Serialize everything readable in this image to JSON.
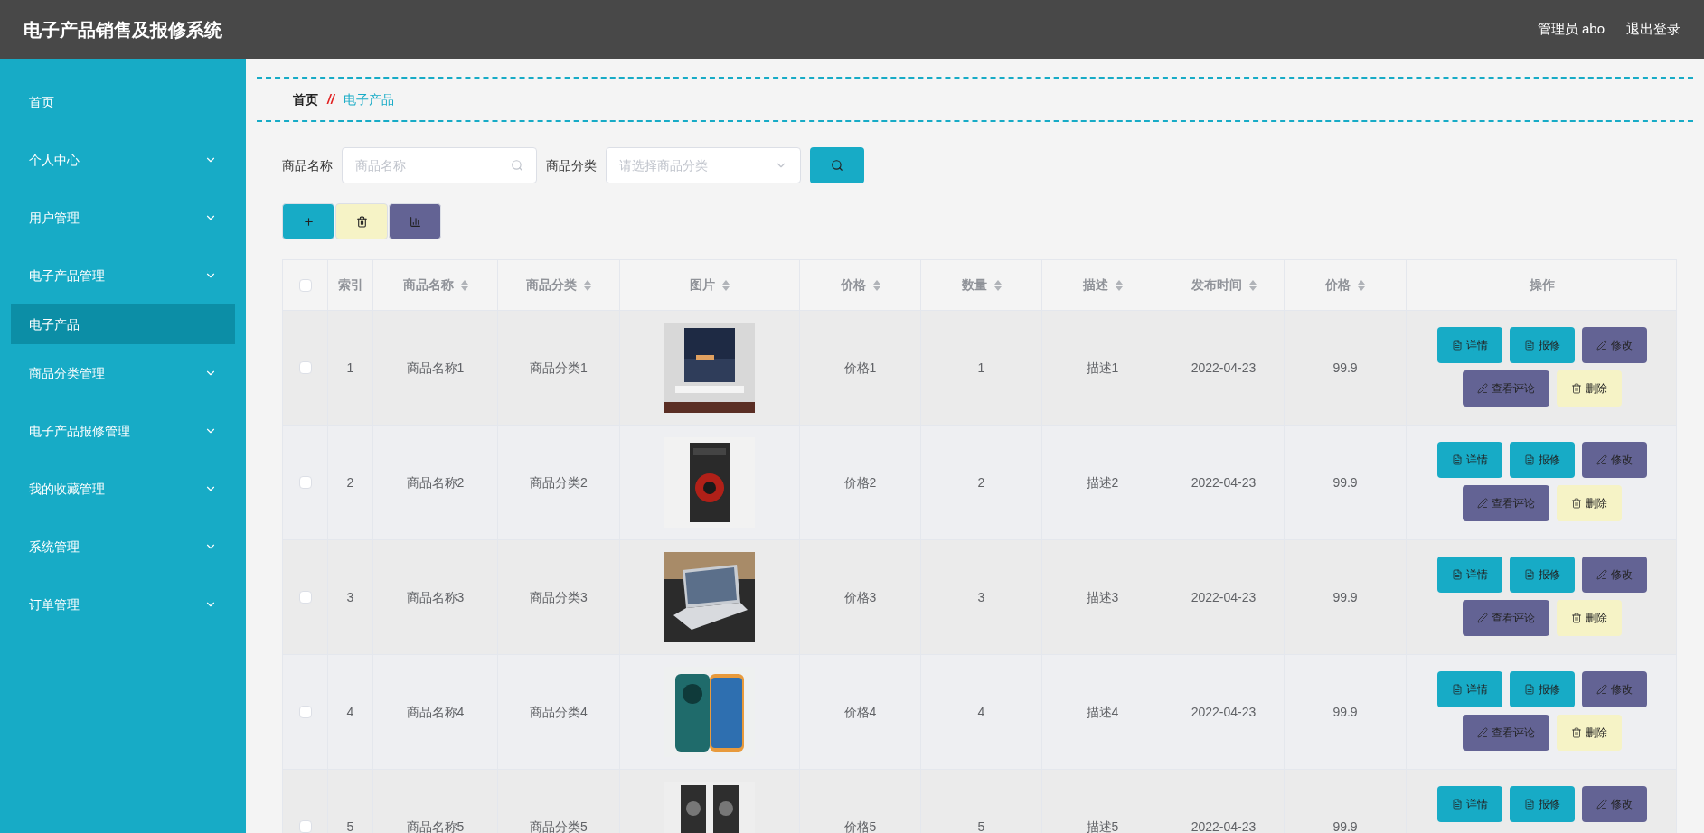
{
  "app": {
    "title": "电子产品销售及报修系统",
    "user": "管理员 abo",
    "logout": "退出登录"
  },
  "sidebar": {
    "items": [
      {
        "label": "首页",
        "expandable": false,
        "selected": false
      },
      {
        "label": "个人中心",
        "expandable": true,
        "selected": false
      },
      {
        "label": "用户管理",
        "expandable": true,
        "selected": false
      },
      {
        "label": "电子产品管理",
        "expandable": true,
        "selected": false
      },
      {
        "label": "电子产品",
        "expandable": false,
        "selected": true
      },
      {
        "label": "商品分类管理",
        "expandable": true,
        "selected": false
      },
      {
        "label": "电子产品报修管理",
        "expandable": true,
        "selected": false
      },
      {
        "label": "我的收藏管理",
        "expandable": true,
        "selected": false
      },
      {
        "label": "系统管理",
        "expandable": true,
        "selected": false
      },
      {
        "label": "订单管理",
        "expandable": true,
        "selected": false
      }
    ]
  },
  "breadcrumb": [
    {
      "label": "首页",
      "current": false
    },
    {
      "label": "电子产品",
      "current": true
    }
  ],
  "breadcrumb_separator": "//",
  "search": {
    "name_label": "商品名称",
    "name_placeholder": "商品名称",
    "category_label": "商品分类",
    "category_placeholder": "请选择商品分类"
  },
  "toolbar": [
    {
      "kind": "add"
    },
    {
      "kind": "delete"
    },
    {
      "kind": "chart"
    }
  ],
  "table": {
    "columns": [
      {
        "kind": "check",
        "checked": false
      },
      {
        "label": "索引",
        "sortable": false
      },
      {
        "label": "商品名称",
        "sortable": true
      },
      {
        "label": "商品分类",
        "sortable": true
      },
      {
        "label": "图片",
        "sortable": true
      },
      {
        "label": "价格",
        "sortable": true
      },
      {
        "label": "数量",
        "sortable": true
      },
      {
        "label": "描述",
        "sortable": true
      },
      {
        "label": "发布时间",
        "sortable": true
      },
      {
        "label": "价格",
        "sortable": true
      },
      {
        "label": "操作",
        "sortable": false
      }
    ],
    "rows": [
      {
        "cells": [
          {
            "kind": "check",
            "checked": false
          },
          "1",
          "商品名称1",
          "商品分类1",
          {
            "kind": "picture"
          },
          "价格1",
          "1",
          "描述1",
          "2022-04-23",
          "99.9",
          {
            "kind": "actions",
            "actions": [
              {
                "kind": "detail",
                "label": "详情"
              },
              {
                "kind": "repair",
                "label": "报修"
              },
              {
                "kind": "edit",
                "label": "修改"
              },
              {
                "kind": "comments",
                "label": "查看评论"
              },
              {
                "kind": "delete",
                "label": "删除"
              }
            ]
          }
        ]
      },
      {
        "cells": [
          {
            "kind": "check",
            "checked": false
          },
          "2",
          "商品名称2",
          "商品分类2",
          {
            "kind": "picture"
          },
          "价格2",
          "2",
          "描述2",
          "2022-04-23",
          "99.9",
          {
            "kind": "actions",
            "actions": [
              {
                "kind": "detail",
                "label": "详情"
              },
              {
                "kind": "repair",
                "label": "报修"
              },
              {
                "kind": "edit",
                "label": "修改"
              },
              {
                "kind": "comments",
                "label": "查看评论"
              },
              {
                "kind": "delete",
                "label": "删除"
              }
            ]
          }
        ]
      },
      {
        "cells": [
          {
            "kind": "check",
            "checked": false
          },
          "3",
          "商品名称3",
          "商品分类3",
          {
            "kind": "picture"
          },
          "价格3",
          "3",
          "描述3",
          "2022-04-23",
          "99.9",
          {
            "kind": "actions",
            "actions": [
              {
                "kind": "detail",
                "label": "详情"
              },
              {
                "kind": "repair",
                "label": "报修"
              },
              {
                "kind": "edit",
                "label": "修改"
              },
              {
                "kind": "comments",
                "label": "查看评论"
              },
              {
                "kind": "delete",
                "label": "删除"
              }
            ]
          }
        ]
      },
      {
        "cells": [
          {
            "kind": "check",
            "checked": false
          },
          "4",
          "商品名称4",
          "商品分类4",
          {
            "kind": "picture"
          },
          "价格4",
          "4",
          "描述4",
          "2022-04-23",
          "99.9",
          {
            "kind": "actions",
            "actions": [
              {
                "kind": "detail",
                "label": "详情"
              },
              {
                "kind": "repair",
                "label": "报修"
              },
              {
                "kind": "edit",
                "label": "修改"
              },
              {
                "kind": "comments",
                "label": "查看评论"
              },
              {
                "kind": "delete",
                "label": "删除"
              }
            ]
          }
        ]
      },
      {
        "cells": [
          {
            "kind": "check",
            "checked": false
          },
          "5",
          "商品名称5",
          "商品分类5",
          {
            "kind": "picture"
          },
          "价格5",
          "5",
          "描述5",
          "2022-04-23",
          "99.9",
          {
            "kind": "actions",
            "actions": [
              {
                "kind": "detail",
                "label": "详情"
              },
              {
                "kind": "repair",
                "label": "报修"
              },
              {
                "kind": "edit",
                "label": "修改"
              }
            ]
          }
        ]
      }
    ]
  }
}
